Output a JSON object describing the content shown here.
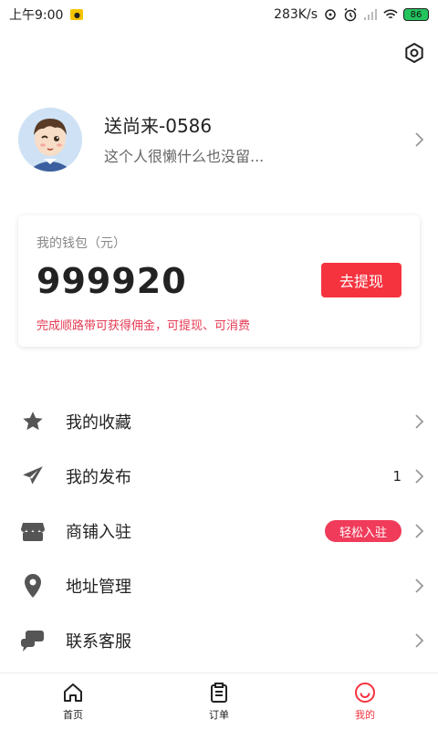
{
  "status_bar": {
    "time": "上午9:00",
    "net_speed": "283K/s",
    "battery": "86"
  },
  "profile": {
    "name": "送尚来-0586",
    "signature": "这个人很懒什么也没留..."
  },
  "wallet": {
    "title": "我的钱包（元）",
    "amount": "999920",
    "withdraw_label": "去提现",
    "note": "完成顺路带可获得佣金，可提现、可消费"
  },
  "menu": [
    {
      "label": "我的收藏",
      "icon": "star-icon"
    },
    {
      "label": "我的发布",
      "icon": "send-icon",
      "count": "1"
    },
    {
      "label": "商铺入驻",
      "icon": "shop-icon",
      "tag": "轻松入驻"
    },
    {
      "label": "地址管理",
      "icon": "location-pin-icon"
    },
    {
      "label": "联系客服",
      "icon": "chat-icon"
    }
  ],
  "tabs": [
    {
      "label": "首页",
      "icon": "home-icon"
    },
    {
      "label": "订单",
      "icon": "clipboard-icon"
    },
    {
      "label": "我的",
      "icon": "smile-icon",
      "active": true
    }
  ],
  "colors": {
    "accent": "#f5333f",
    "tag": "#f03b5a",
    "note": "#e63b54"
  }
}
